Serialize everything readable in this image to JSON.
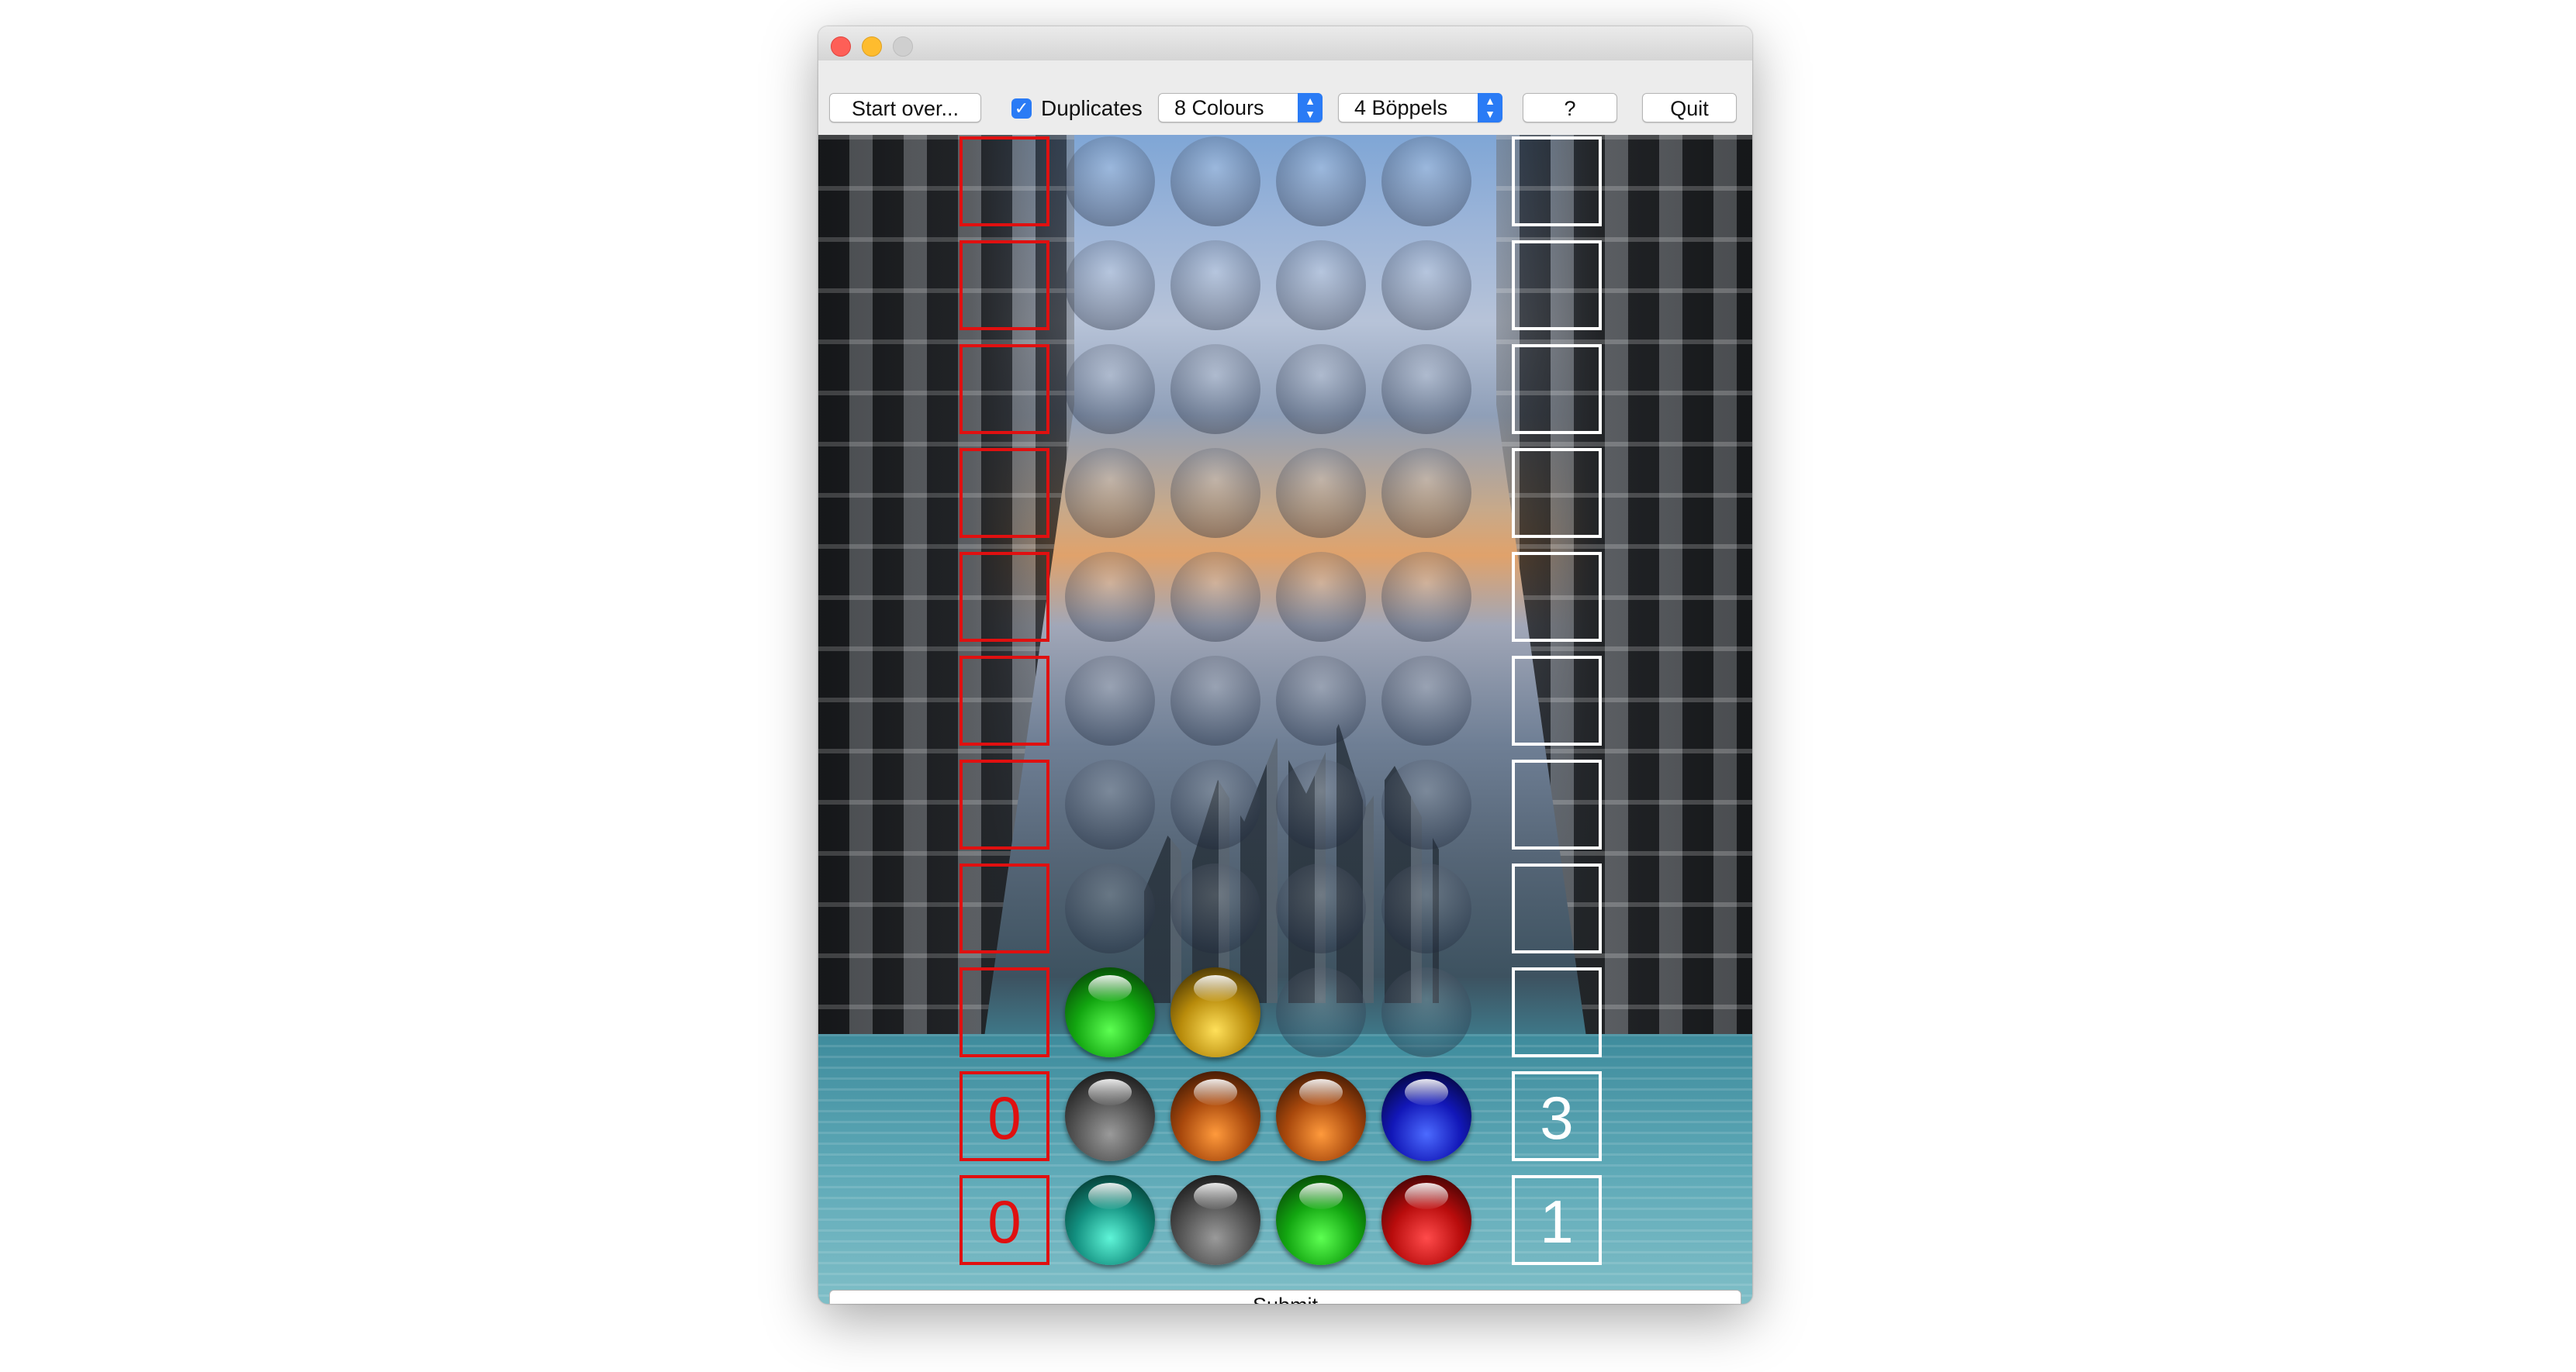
{
  "toolbar": {
    "start_over_label": "Start over...",
    "duplicates_label": "Duplicates",
    "duplicates_checked": true,
    "colours_value": "8 Colours",
    "boppels_value": "4 Böppels",
    "help_label": "?",
    "quit_label": "Quit"
  },
  "board": {
    "rows": [
      {
        "balls": [],
        "black_score": "",
        "white_score": ""
      },
      {
        "balls": [],
        "black_score": "",
        "white_score": ""
      },
      {
        "balls": [],
        "black_score": "",
        "white_score": ""
      },
      {
        "balls": [],
        "black_score": "",
        "white_score": ""
      },
      {
        "balls": [],
        "black_score": "",
        "white_score": ""
      },
      {
        "balls": [],
        "black_score": "",
        "white_score": ""
      },
      {
        "balls": [],
        "black_score": "",
        "white_score": ""
      },
      {
        "balls": [],
        "black_score": "",
        "white_score": ""
      },
      {
        "balls": [
          "green",
          "yellow",
          "",
          ""
        ],
        "black_score": "",
        "white_score": ""
      },
      {
        "balls": [
          "grey",
          "orange",
          "orange",
          "blue"
        ],
        "black_score": "0",
        "white_score": "3"
      },
      {
        "balls": [
          "teal",
          "grey",
          "green",
          "red"
        ],
        "black_score": "0",
        "white_score": "1"
      }
    ]
  },
  "submit_label": "Submit",
  "colors": {
    "score_red": "#e01010",
    "score_white": "#ffffff",
    "accent_blue": "#2a7bf5"
  }
}
